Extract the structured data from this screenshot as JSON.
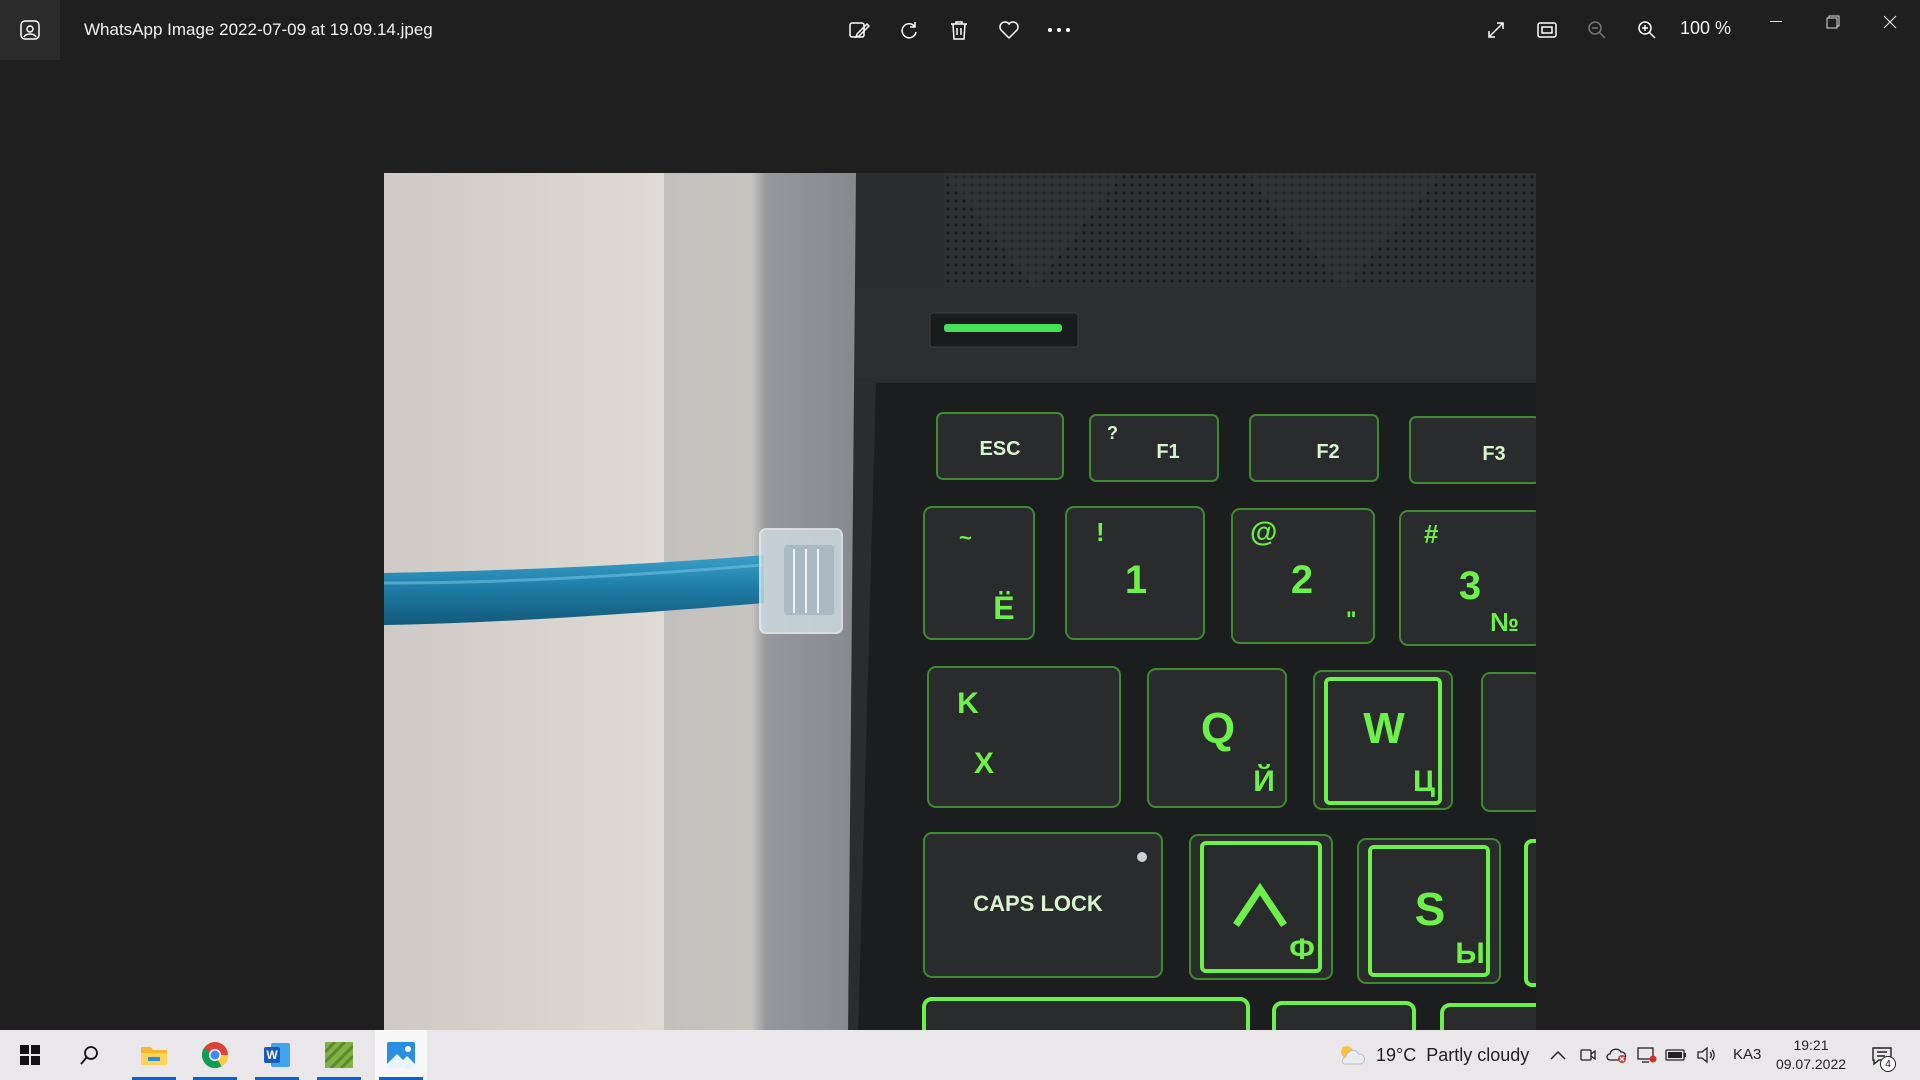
{
  "window": {
    "filename": "WhatsApp Image 2022-07-09 at 19.09.14.jpeg",
    "zoom_level": "100 %"
  },
  "toolbar": {
    "icons": [
      "edit-image-icon",
      "rotate-icon",
      "delete-icon",
      "favorite-icon",
      "more-icon"
    ],
    "right_icons": [
      "full-screen-icon",
      "fit-to-window-icon",
      "zoom-out-icon",
      "zoom-in-icon"
    ]
  },
  "photo": {
    "keys": {
      "esc": "ESC",
      "f1": "F1",
      "f1_alt": "?",
      "f2": "F2",
      "f3": "F3",
      "tilde": "~",
      "tilde_ru": "Ё",
      "one": "1",
      "one_alt": "!",
      "two": "2",
      "two_alt": "@",
      "two_ru": "\"",
      "three": "3",
      "three_alt": "#",
      "three_ru": "№",
      "tab_top": "K",
      "tab_bottom": "X",
      "q": "Q",
      "q_ru": "Й",
      "w": "W",
      "w_ru": "Ц",
      "caps": "CAPS LOCK",
      "a": "A",
      "a_ru": "Ф",
      "s": "S",
      "s_ru": "Ы"
    },
    "accent_color": "#5bd62f",
    "cable_color": "#1f7fa8"
  },
  "taskbar": {
    "apps": [
      "start-icon",
      "search-icon",
      "file-explorer-icon",
      "chrome-icon",
      "word-icon",
      "app-icon",
      "photos-icon"
    ],
    "weather_temp": "19°C",
    "weather_desc": "Partly cloudy",
    "language": "KA3",
    "time": "19:21",
    "date": "09.07.2022",
    "notification_count": "4"
  }
}
